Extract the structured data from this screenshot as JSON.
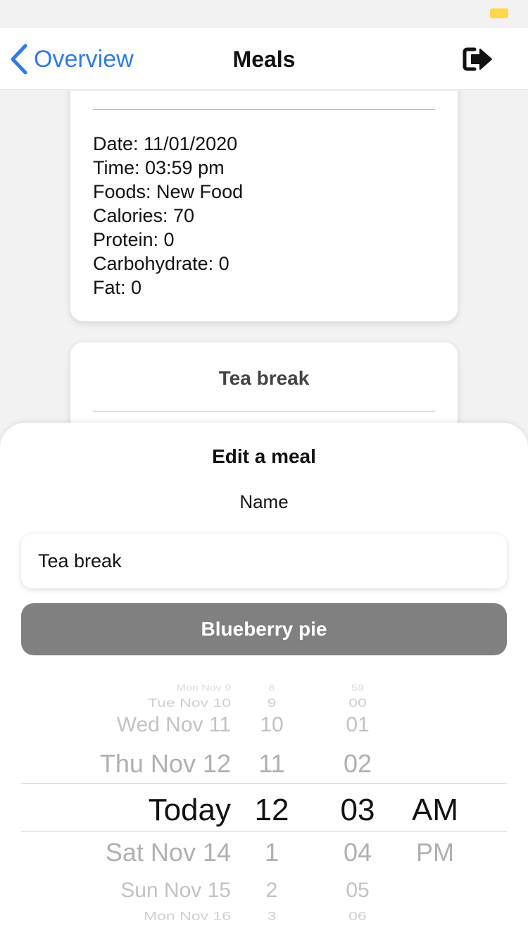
{
  "navbar": {
    "back_label": "Overview",
    "title": "Meals",
    "logout_icon": "sign-out-icon"
  },
  "meal_card": {
    "details": [
      "Date: 11/01/2020",
      "Time: 03:59 pm",
      "Foods: New Food",
      "Calories: 70",
      "Protein: 0",
      "Carbohydrate: 0",
      "Fat: 0"
    ]
  },
  "next_card": {
    "title": "Tea break"
  },
  "sheet": {
    "title": "Edit a meal",
    "name_label": "Name",
    "name_value": "Tea break",
    "food_button": "Blueberry pie"
  },
  "picker": {
    "days": [
      "Mon Nov 9",
      "Tue Nov 10",
      "Wed Nov 11",
      "Thu Nov 12",
      "Today",
      "Sat Nov 14",
      "Sun Nov 15",
      "Mon Nov 16"
    ],
    "hours": [
      "8",
      "9",
      "10",
      "11",
      "12",
      "1",
      "2",
      "3"
    ],
    "minutes": [
      "59",
      "00",
      "01",
      "02",
      "03",
      "04",
      "05",
      "06"
    ],
    "ampm": [
      "AM",
      "PM"
    ],
    "selected": {
      "day": "Today",
      "hour": "12",
      "minute": "03",
      "ampm": "AM"
    }
  },
  "colors": {
    "accent": "#2f7ae5",
    "food_button_bg": "#808080",
    "battery": "#ffd84a"
  }
}
